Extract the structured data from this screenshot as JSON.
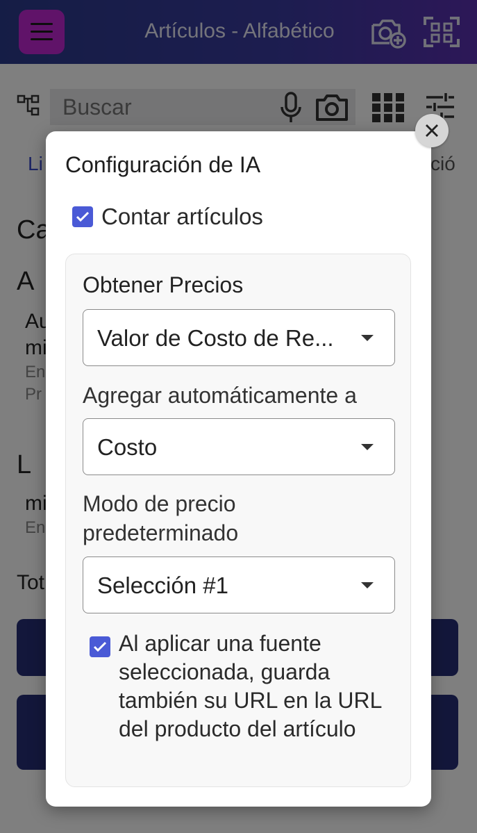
{
  "app": {
    "title": "Artículos - Alfabético"
  },
  "search": {
    "placeholder": "Buscar"
  },
  "background": {
    "tab_left": "Li",
    "tab_right": "ció",
    "heading": "Ca",
    "letter_a": "A",
    "row1_line1": "Au",
    "row1_line2": "mi",
    "row1_line3": "En",
    "row1_line4": "Pr",
    "letter_l": "L",
    "row2_line1": "mi",
    "row2_line2": "En",
    "total": "Tot"
  },
  "dialog": {
    "title": "Configuración de IA",
    "count_items": {
      "label": "Contar artículos",
      "checked": true
    },
    "section_title": "Obtener Precios",
    "price_source": {
      "value": "Valor de Costo de Re..."
    },
    "auto_add": {
      "label": "Agregar automáticamente a",
      "value": "Costo"
    },
    "default_mode": {
      "label": "Modo de precio predeterminado",
      "value": "Selección #1"
    },
    "save_url": {
      "label": "Al aplicar una fuente seleccionada, guarda también su URL en la URL del producto del artículo",
      "checked": true
    }
  },
  "colors": {
    "accent": "#4a5ad6",
    "topbar": "#2b3a8c",
    "menu": "#c026d3",
    "primary_button": "#262e76"
  }
}
